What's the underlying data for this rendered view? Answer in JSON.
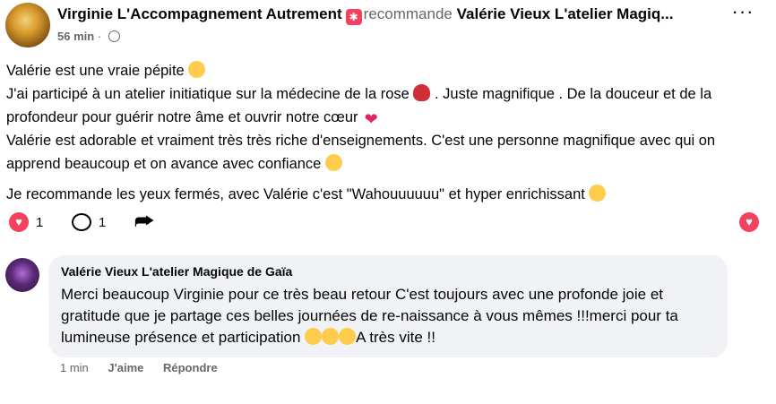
{
  "post": {
    "author": "Virginie L'Accompagnement Autrement",
    "recommend_text": "recommande",
    "page_name": "Valérie Vieux L'atelier Magiq...",
    "time": "56 min",
    "separator": "·",
    "lines": [
      {
        "text": "Valérie est une vraie pépite",
        "emoji_after": "star-struck"
      },
      {
        "text": "J'ai participé à un atelier initiatique sur la médecine de la rose",
        "emoji_after": "rose"
      },
      {
        "text": ". Juste magnifique . De la douceur et de la profondeur pour guérir notre âme et ouvrir notre cœur",
        "emoji_after": "broken-heart"
      },
      {
        "text": "Valérie est adorable et vraiment très très riche d'enseignements. C'est une personne magnifique avec qui on apprend beaucoup et on avance avec confiance",
        "emoji_after": "smiling-face-with-hearts"
      }
    ],
    "line2_a": "Valérie est une vraie pépite",
    "line2_b": "J'ai participé à un atelier initiatique sur la médecine de la rose",
    "line2_c": ". Juste magnifique . De la douceur et de la profondeur pour guérir notre âme et ouvrir notre cœur",
    "line2_d": "Valérie est adorable et vraiment très très riche d'enseignements. C'est une personne magnifique avec qui on apprend beaucoup et on avance avec confiance",
    "line2_e": "Je recommande les yeux fermés, avec Valérie c'est \"Wahouuuuuu\" et hyper enrichissant"
  },
  "actions": {
    "reactions_count": "1",
    "comments_count": "1"
  },
  "reply": {
    "author": "Valérie Vieux L'atelier Magique de Gaïa",
    "text_main": "Merci beaucoup Virginie pour ce très beau retour C'est toujours avec une profonde joie et gratitude que je partage ces belles journées de re-naissance à vous mêmes !!!merci pour ta lumineuse présence et participation",
    "text_end": "A très vite !!",
    "time": "1 min",
    "like_label": "J'aime",
    "reply_label": "Répondre"
  },
  "icons": [
    "recommend-icon",
    "globe-icon",
    "more-options-icon",
    "heart-reaction-icon",
    "comment-icon",
    "share-icon",
    "react-heart-icon"
  ],
  "colors": {
    "accent_red": "#f3425f",
    "secondary_text": "#65676b",
    "bubble_bg": "#f0f2f5"
  }
}
